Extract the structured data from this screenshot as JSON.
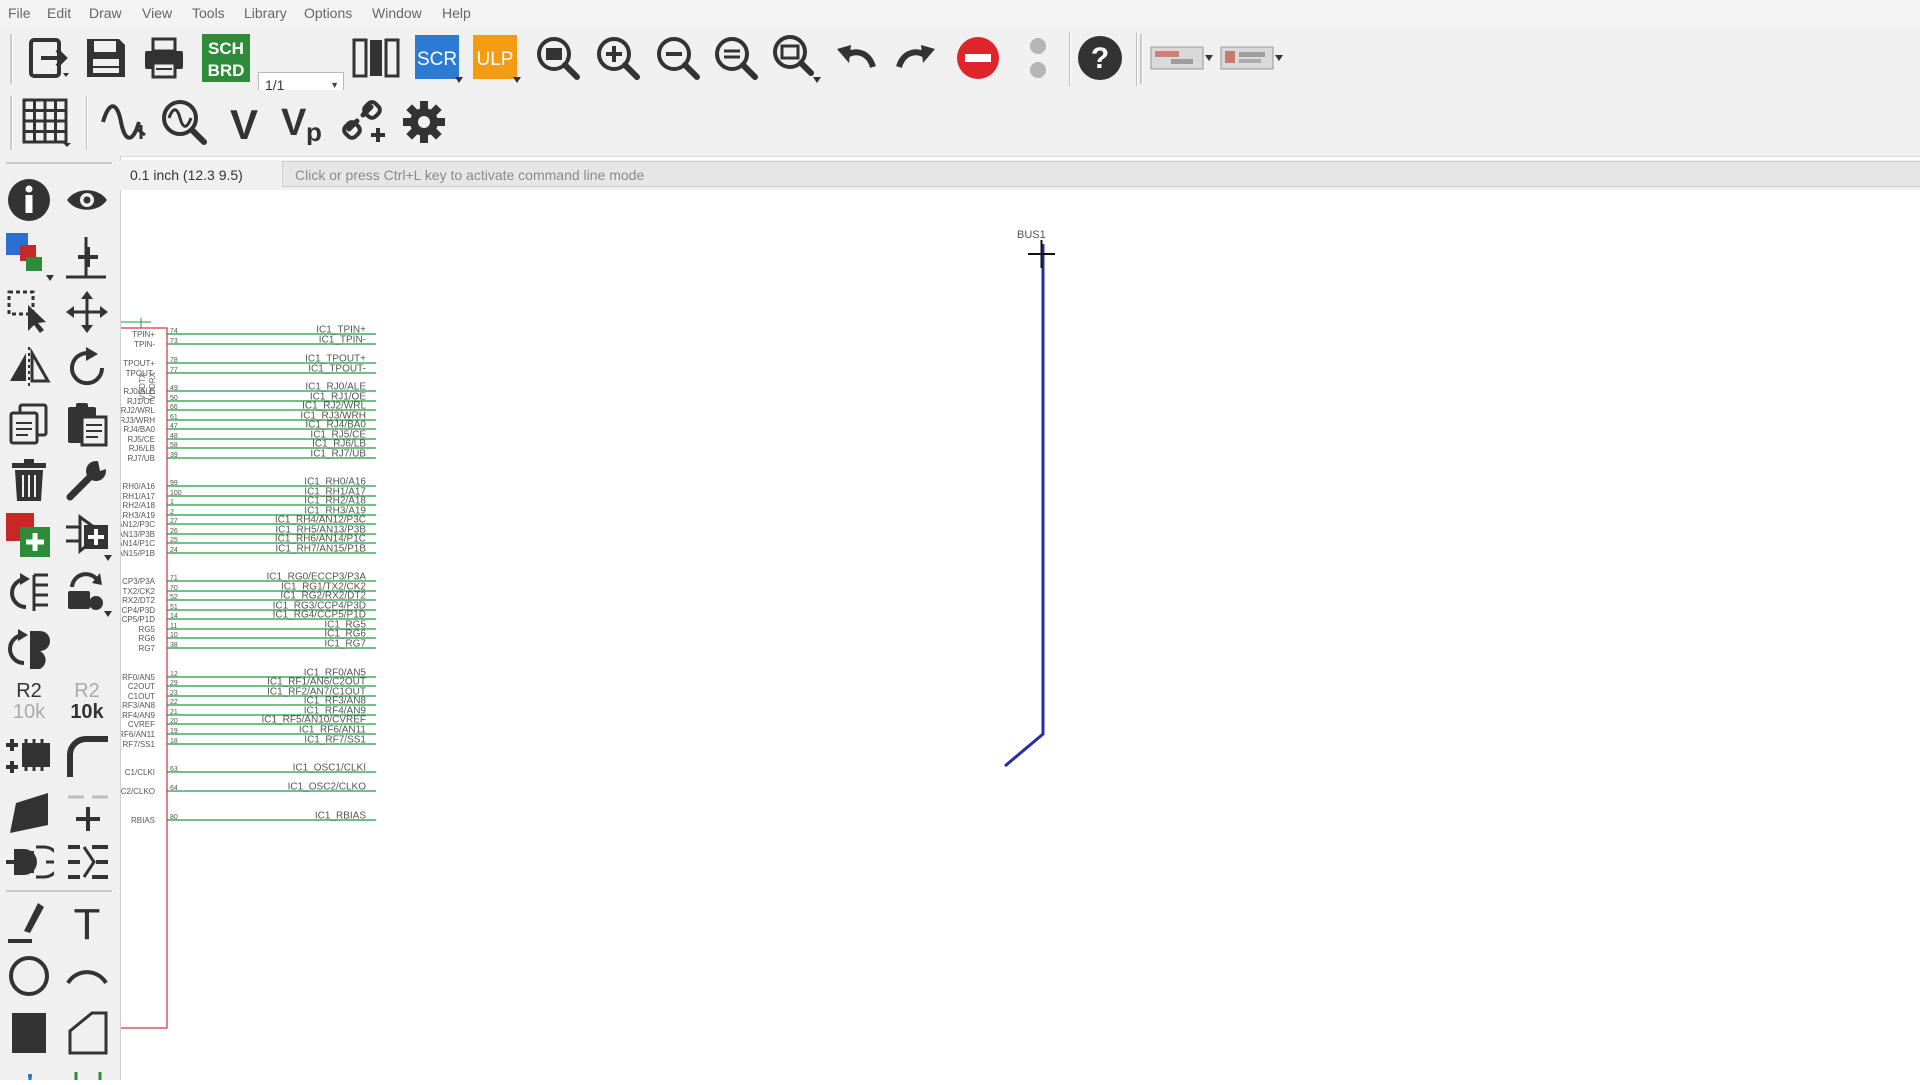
{
  "menu": [
    "File",
    "Edit",
    "Draw",
    "View",
    "Tools",
    "Library",
    "Options",
    "Window",
    "Help"
  ],
  "toolbar": {
    "page_select": "1/1",
    "sch_brd_top": "SCH",
    "sch_brd_bottom": "BRD",
    "scr_label": "SCR",
    "ulp_label": "ULP"
  },
  "status": {
    "grid_coord": "0.1 inch (12.3 9.5)",
    "command_placeholder": "Click or press Ctrl+L key to activate command line mode"
  },
  "left_tools": {
    "value_name": "R2",
    "value_value": "10k"
  },
  "schematic": {
    "bus_label": "BUS1",
    "symbol_top_pins": [
      "VDDTX",
      "VDDRX"
    ],
    "pins": [
      {
        "pin": "TPIN+",
        "num": "74",
        "net": "IC1_TPIN+"
      },
      {
        "pin": "TPIN-",
        "num": "73",
        "net": "IC1_TPIN-"
      },
      {
        "pin": "TPOUT+",
        "num": "78",
        "net": "IC1_TPOUT+"
      },
      {
        "pin": "TPOUT-",
        "num": "77",
        "net": "IC1_TPOUT-"
      },
      {
        "pin": "RJ0/ALE",
        "num": "49",
        "net": "IC1_RJ0/ALE"
      },
      {
        "pin": "RJ1/OE",
        "num": "50",
        "net": "IC1_RJ1/OE"
      },
      {
        "pin": "RJ2/WRL",
        "num": "66",
        "net": "IC1_RJ2/WRL"
      },
      {
        "pin": "RJ3/WRH",
        "num": "61",
        "net": "IC1_RJ3/WRH"
      },
      {
        "pin": "RJ4/BA0",
        "num": "47",
        "net": "IC1_RJ4/BA0"
      },
      {
        "pin": "RJ5/CE",
        "num": "48",
        "net": "IC1_RJ5/CE"
      },
      {
        "pin": "RJ6/LB",
        "num": "58",
        "net": "IC1_RJ6/LB"
      },
      {
        "pin": "RJ7/UB",
        "num": "39",
        "net": "IC1_RJ7/UB"
      },
      {
        "pin": "RH0/A16",
        "num": "99",
        "net": "IC1_RH0/A16"
      },
      {
        "pin": "RH1/A17",
        "num": "100",
        "net": "IC1_RH1/A17"
      },
      {
        "pin": "RH2/A18",
        "num": "1",
        "net": "IC1_RH2/A18"
      },
      {
        "pin": "RH3/A19",
        "num": "2",
        "net": "IC1_RH3/A19"
      },
      {
        "pin": "AN12/P3C",
        "num": "27",
        "net": "IC1_RH4/AN12/P3C"
      },
      {
        "pin": "AN13/P3B",
        "num": "26",
        "net": "IC1_RH5/AN13/P3B"
      },
      {
        "pin": "AN14/P1C",
        "num": "25",
        "net": "IC1_RH6/AN14/P1C"
      },
      {
        "pin": "AN15/P1B",
        "num": "24",
        "net": "IC1_RH7/AN15/P1B"
      },
      {
        "pin": "CP3/P3A",
        "num": "71",
        "net": "IC1_RG0/ECCP3/P3A"
      },
      {
        "pin": "TX2/CK2",
        "num": "70",
        "net": "IC1_RG1/TX2/CK2"
      },
      {
        "pin": "RX2/DT2",
        "num": "52",
        "net": "IC1_RG2/RX2/DT2"
      },
      {
        "pin": "CP4/P3D",
        "num": "51",
        "net": "IC1_RG3/CCP4/P3D"
      },
      {
        "pin": "CP5/P1D",
        "num": "14",
        "net": "IC1_RG4/CCP5/P1D"
      },
      {
        "pin": "RG5",
        "num": "11",
        "net": "IC1_RG5"
      },
      {
        "pin": "RG6",
        "num": "10",
        "net": "IC1_RG6"
      },
      {
        "pin": "RG7",
        "num": "38",
        "net": "IC1_RG7"
      },
      {
        "pin": "RF0/AN5",
        "num": "12",
        "net": "IC1_RF0/AN5"
      },
      {
        "pin": "C2OUT",
        "num": "29",
        "net": "IC1_RF1/AN6/C2OUT"
      },
      {
        "pin": "C1OUT",
        "num": "23",
        "net": "IC1_RF2/AN7/C1OUT"
      },
      {
        "pin": "RF3/AN8",
        "num": "22",
        "net": "IC1_RF3/AN8"
      },
      {
        "pin": "RF4/AN9",
        "num": "21",
        "net": "IC1_RF4/AN9"
      },
      {
        "pin": "CVREF",
        "num": "20",
        "net": "IC1_RF5/AN10/CVREF"
      },
      {
        "pin": "RF6/AN11",
        "num": "19",
        "net": "IC1_RF6/AN11"
      },
      {
        "pin": "RF7/SS1",
        "num": "18",
        "net": "IC1_RF7/SS1"
      },
      {
        "pin": "C1/CLKI",
        "num": "63",
        "net": "IC1_OSC1/CLKI"
      },
      {
        "pin": "C2/CLKO",
        "num": "64",
        "net": "IC1_OSC2/CLKO"
      },
      {
        "pin": "RBIAS",
        "num": "80",
        "net": "IC1_RBIAS"
      }
    ]
  },
  "colors": {
    "net_wire": "#1f9a3c",
    "symbol_body": "#c8323c",
    "bus": "#2b2f9e",
    "stop_red": "#e0242c",
    "scr_blue": "#2b7bd4",
    "ulp_orange": "#f39c12",
    "sch_green": "#2e8b3a"
  }
}
